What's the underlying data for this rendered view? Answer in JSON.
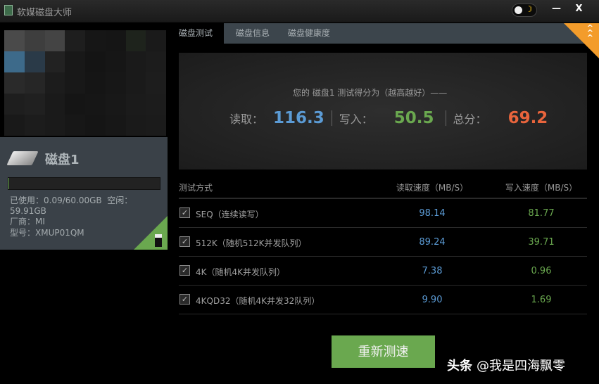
{
  "app": {
    "title": "软媒磁盘大师",
    "minimize_label": "—",
    "close_label": "X",
    "theme_icon": "moon-icon"
  },
  "disk": {
    "name": "磁盘1",
    "used_fraction": 0.0015,
    "used": "已使用：0.09/60.00GB",
    "free": "空闲：59.91GB",
    "vendor": "厂商：MI",
    "model": "型号：XMUP01QM"
  },
  "tabs": [
    {
      "label": "磁盘测试"
    },
    {
      "label": "磁盘信息"
    },
    {
      "label": "磁盘健康度"
    }
  ],
  "score": {
    "caption": "您的 磁盘1 测试得分为（越高越好）——",
    "read_label": "读取：",
    "read": "116.3",
    "write_label": "写入：",
    "write": "50.5",
    "total_label": "总分：",
    "total": "69.2"
  },
  "colors": {
    "read": "#5b9bd5",
    "write": "#6aa84f",
    "total": "#e8643c"
  },
  "table": {
    "headers": [
      "测试方式",
      "读取速度（MB/S）",
      "写入速度（MB/S）"
    ],
    "rows": [
      {
        "name": "SEQ（连续读写）",
        "read": "98.14",
        "write": "81.77"
      },
      {
        "name": "512K（随机512K并发队列）",
        "read": "89.24",
        "write": "39.71"
      },
      {
        "name": "4K（随机4K并发队列）",
        "read": "7.38",
        "write": "0.96"
      },
      {
        "name": "4KQD32（随机4K并发32队列）",
        "read": "9.90",
        "write": "1.69"
      }
    ]
  },
  "retest_label": "重新测速",
  "watermark": {
    "brand": "头条",
    "handle": "@我是四海飘零"
  }
}
